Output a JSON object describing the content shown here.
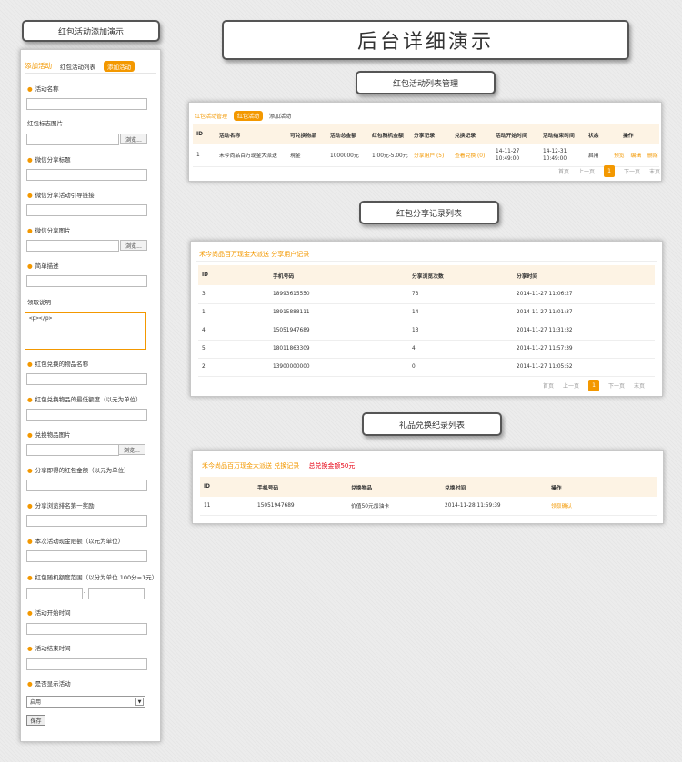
{
  "titles": {
    "form": "红包活动添加演示",
    "main": "后台详细演示",
    "activity_list": "红包活动列表管理",
    "share_list": "红包分享记录列表",
    "gift_list": "礼品兑换纪录列表"
  },
  "form": {
    "tabs": [
      "添加活动",
      "红包活动列表",
      "添加活动"
    ],
    "labels": {
      "name": "活动名称",
      "logo": "红包标志图片",
      "wx_title": "微信分享标题",
      "wx_link": "微信分享活动引导链接",
      "wx_img": "微信分享图片",
      "desc": "简单描述",
      "rules": "领取说明",
      "item_name": "红包兑换的物品名称",
      "min_amount": "红包兑换物品的最低额度（以元为单位）",
      "item_img": "兑换物品图片",
      "share_amount": "分享即得的红包金额（以元为单位）",
      "top_reward": "分享浏览排名第一奖励",
      "cash_limit": "本次活动现金限额（以元为单位）",
      "random_range": "红包随机额度范围（以分为单位 100分=1元）",
      "start_time": "活动开始时间",
      "end_time": "活动结束时间",
      "show": "是否显示活动"
    },
    "browse": "浏览...",
    "rules_value": "<p></p>",
    "range_sep": "-",
    "show_value": "启用",
    "save": "保存"
  },
  "activity": {
    "tabs": [
      "红包活动管理",
      "红包活动",
      "添加活动"
    ],
    "headers": [
      "ID",
      "活动名称",
      "可兑换物品",
      "活动总金额",
      "红包随机金额",
      "分享记录",
      "兑换记录",
      "活动开始时间",
      "活动结束时间",
      "状态",
      "操作"
    ],
    "row": {
      "id": "1",
      "name": "禾今尚品百万现金大派送",
      "item": "現金",
      "total": "1000000元",
      "range": "1.00元-5.00元",
      "share": "分享用户 (5)",
      "exchange": "查看兑换 (0)",
      "start_date": "14-11-27",
      "start_time": "10:49:00",
      "end_date": "14-12-31",
      "end_time": "10:49:00",
      "status": "启用",
      "op1": "预览",
      "op2": "编辑",
      "op3": "删除"
    },
    "pager": [
      "首页",
      "上一页",
      "1",
      "下一页",
      "末页"
    ]
  },
  "share": {
    "title": "禾今尚品百万现金大派送 分享用户记录",
    "headers": [
      "ID",
      "手机号码",
      "分享浏览次数",
      "分享时间"
    ],
    "rows": [
      [
        "3",
        "18993615550",
        "73",
        "2014-11-27 11:06:27"
      ],
      [
        "1",
        "18915888111",
        "14",
        "2014-11-27 11:01:37"
      ],
      [
        "4",
        "15051947689",
        "13",
        "2014-11-27 11:31:32"
      ],
      [
        "5",
        "18011863309",
        "4",
        "2014-11-27 11:57:39"
      ],
      [
        "2",
        "13900000000",
        "0",
        "2014-11-27 11:05:52"
      ]
    ],
    "pager": [
      "首页",
      "上一页",
      "1",
      "下一页",
      "末页"
    ]
  },
  "gift": {
    "title": "禾今尚品百万现金大派送 兑换记录",
    "total": "总兑换金额50元",
    "headers": [
      "ID",
      "手机号码",
      "兑换物品",
      "兑换时间",
      "操作"
    ],
    "row": {
      "id": "11",
      "phone": "15051947689",
      "item": "价值50元加油卡",
      "time": "2014-11-28 11:59:39",
      "op": "领取确认"
    }
  }
}
